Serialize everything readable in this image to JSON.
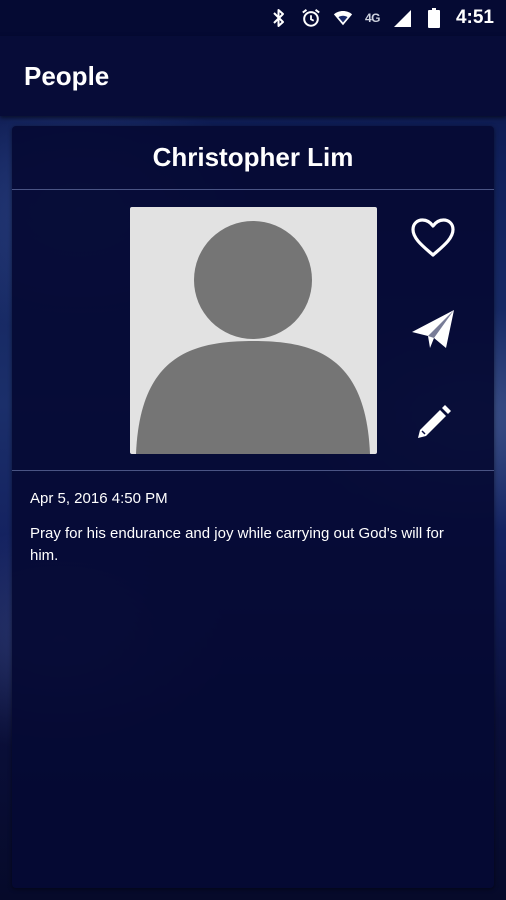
{
  "status_bar": {
    "network": "4G",
    "time": "4:51",
    "icons": [
      "bluetooth-icon",
      "alarm-icon",
      "wifi-icon",
      "signal-icon",
      "battery-icon"
    ]
  },
  "app_bar": {
    "title": "People"
  },
  "person": {
    "name": "Christopher Lim",
    "date": "Apr 5, 2016 4:50 PM",
    "note": "Pray for his endurance and joy while carrying out God's will for him."
  },
  "actions": [
    {
      "icon": "heart-icon"
    },
    {
      "icon": "send-icon"
    },
    {
      "icon": "edit-icon"
    }
  ],
  "colors": {
    "status_bar": "#050a33",
    "app_bar": "#070c38",
    "card": "#050a34",
    "placeholder_bg": "#e2e2e2",
    "placeholder_figure": "#757575"
  }
}
